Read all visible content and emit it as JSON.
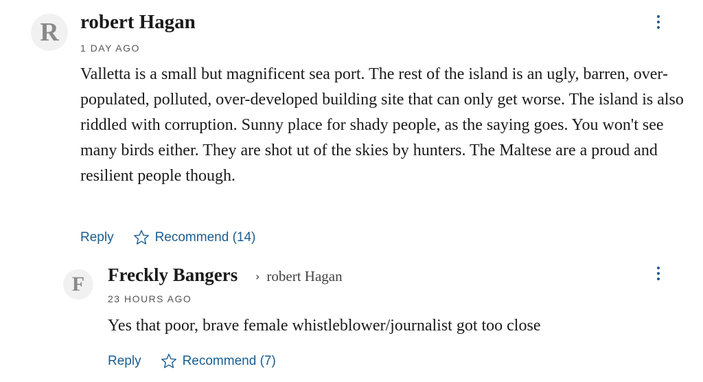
{
  "comments": [
    {
      "avatar_letter": "R",
      "author": "robert Hagan",
      "time": "1 DAY AGO",
      "text": "Valletta is a small but magnificent sea port. The rest of the island is an ugly, barren, over-populated, polluted, over-developed  building site that can only get worse. The island is also riddled with corruption. Sunny place for shady people, as the saying goes. You won't see many birds either. They are shot ut of the skies by hunters. The Maltese are a proud and resilient people though.",
      "reply_label": "Reply",
      "recommend_label": "Recommend (14)"
    },
    {
      "avatar_letter": "F",
      "author": "Freckly Bangers",
      "reply_to": "robert Hagan",
      "time": "23 HOURS AGO",
      "text": "Yes that poor, brave  female whistleblower/journalist got too close",
      "reply_label": "Reply",
      "recommend_label": "Recommend (7)"
    }
  ],
  "icons": {
    "star": "star-outline-icon",
    "menu": "more-vertical-icon",
    "chevron": "chevron-right-icon"
  },
  "colors": {
    "accent": "#1c5d8f",
    "avatar_bg": "#f1f1f1"
  }
}
